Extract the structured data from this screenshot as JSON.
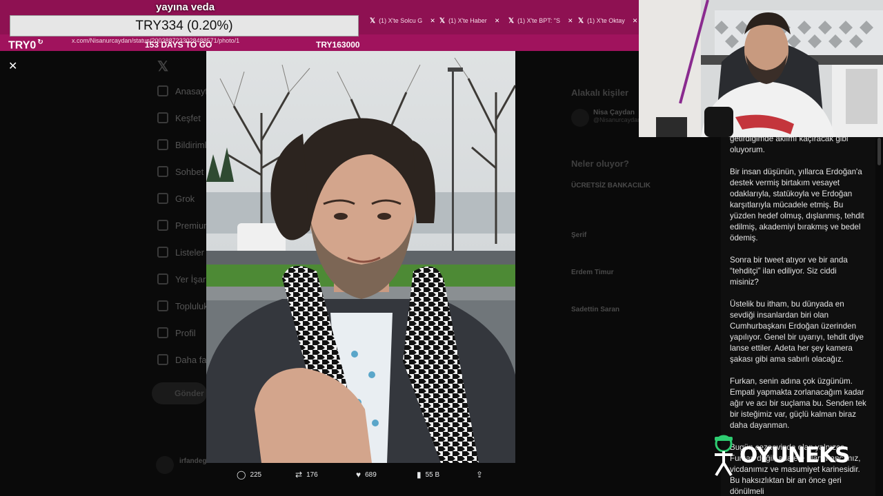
{
  "overlay": {
    "banner_text": "yayına veda",
    "price_box": "TRY334 (0.20%)",
    "counter_left": "TRY0",
    "days_to_go": "153 DAYS TO GO",
    "counter_right": "TRY163000"
  },
  "browser": {
    "url": "x.com/Nisanurcaydan/status/2003887233028488571/photo/1",
    "tabs": [
      {
        "label": "(1) X'te Solcu G"
      },
      {
        "label": "(1) X'te Haber"
      },
      {
        "label": "(1) X'te BPT: \"S"
      },
      {
        "label": "(1) X'te Oktay"
      }
    ]
  },
  "x_background": {
    "sidebar": [
      "Anasayfa",
      "Keşfet",
      "Bildirimler",
      "Sohbet",
      "Grok",
      "Premium",
      "Listeler",
      "Yer İşaretleri",
      "Topluluklar",
      "Profil",
      "Daha fazla"
    ],
    "post_button": "Gönder",
    "right_header": "Alakalı kişiler",
    "related_name": "Nisa Çaydan",
    "related_handle": "@Nisanurcaydan",
    "trends_header": "Neler oluyor?",
    "trends": [
      {
        "title": "ÜCRETSİZ BANKACILIK",
        "sub": ""
      },
      {
        "title": "Şerif",
        "sub": ""
      },
      {
        "title": "Erdem Timur",
        "sub": ""
      },
      {
        "title": "Sadettin Saran",
        "sub": ""
      }
    ],
    "reply_user": "irfandeg"
  },
  "post_stats": {
    "replies": "225",
    "reposts": "176",
    "likes": "689",
    "views": "55 B"
  },
  "article": {
    "lead_fragment": "getirdiğimde aklımı kaçıracak gibi oluyorum.",
    "paragraphs": [
      "Bir insan düşünün, yıllarca Erdoğan'a destek vermiş birtakım vesayet odaklarıyla, statükoyla ve Erdoğan karşıtlarıyla mücadele etmiş. Bu yüzden hedef olmuş, dışlanmış, tehdit edilmiş, akademiyi bırakmış ve bedel ödemiş.",
      "Sonra bir tweet atıyor ve bir anda “tehditçi” ilan ediliyor. Siz ciddi misiniz?",
      "Üstelik bu itham, bu dünyada en sevdiği insanlardan biri olan Cumhurbaşkanı Erdoğan üzerinden yapılıyor. Genel bir uyarıyı, tehdit diye lanse ettiler. Adeta her şey kamera şakası gibi ama sabırlı olacağız.",
      "Furkan, senin adına çok üzgünüm. Empati yapmakta zorlanacağım kadar ağır ve acı bir suçlama bu. Senden tek bir isteğimiz var, güçlü kalman biraz daha dayanman.",
      "Bugün cezaevinde olan yalnızca Furkan değil; adalete olan inancımız, vicdanımız ve masumiyet karinesidir. Bu haksızlıktan bir an önce geri dönülmeli"
    ]
  },
  "watermark": "OYUNEKS",
  "colors": {
    "chrome_magenta": "#8e1152",
    "panel_bg": "#0f0f0f"
  }
}
